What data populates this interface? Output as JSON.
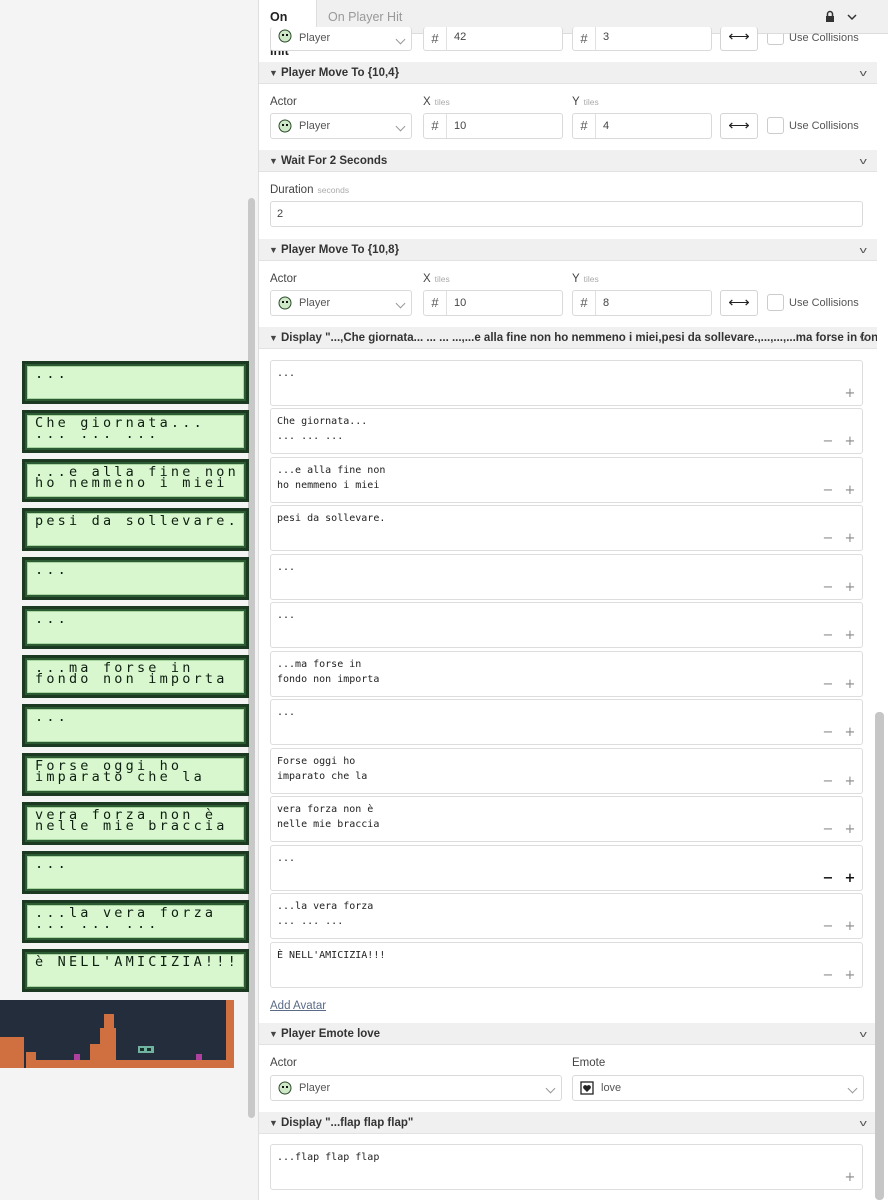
{
  "tabs": {
    "active": "On Init",
    "inactive": "On Player Hit"
  },
  "tab_icons": [
    "lock-icon",
    "chevron-down-icon"
  ],
  "top_partial": {
    "actor": "Player",
    "x": "42",
    "y": "3",
    "collisions_label": "Use Collisions"
  },
  "move1": {
    "header": "Player Move To {10,4}",
    "actor_label": "Actor",
    "x_label": "X",
    "y_label": "Y",
    "unit": "tiles",
    "actor": "Player",
    "x": "10",
    "y": "4",
    "collisions_label": "Use Collisions"
  },
  "wait": {
    "header": "Wait For 2 Seconds",
    "label": "Duration",
    "unit": "seconds",
    "value": "2"
  },
  "move2": {
    "header": "Player Move To {10,8}",
    "actor_label": "Actor",
    "x_label": "X",
    "y_label": "Y",
    "unit": "tiles",
    "actor": "Player",
    "x": "10",
    "y": "8",
    "collisions_label": "Use Collisions"
  },
  "display1": {
    "header": "Display \"...,Che giornata... ... ... ...,...e alla fine non ho nemmeno i miei,pesi da sollevare.,...,...,...ma forse in fond...",
    "dialogues": [
      {
        "l1": "...",
        "l2": ""
      },
      {
        "l1": "Che giornata...",
        "l2": "... ... ..."
      },
      {
        "l1": "...e alla fine non",
        "l2": "ho nemmeno i miei"
      },
      {
        "l1": "pesi da sollevare.",
        "l2": ""
      },
      {
        "l1": "...",
        "l2": ""
      },
      {
        "l1": "...",
        "l2": ""
      },
      {
        "l1": "...ma forse in",
        "l2": "fondo non importa"
      },
      {
        "l1": "...",
        "l2": ""
      },
      {
        "l1": "Forse oggi ho",
        "l2": "imparato che la"
      },
      {
        "l1": "vera forza non è",
        "l2": "nelle mie braccia"
      },
      {
        "l1": "...",
        "l2": ""
      },
      {
        "l1": "...la vera forza",
        "l2": "... ... ..."
      },
      {
        "l1": "È NELL'AMICIZIA!!!",
        "l2": ""
      }
    ],
    "add_avatar": "Add Avatar"
  },
  "emote": {
    "header": "Player Emote love",
    "actor_label": "Actor",
    "emote_label": "Emote",
    "actor": "Player",
    "emote": "love"
  },
  "display2": {
    "header": "Display \"...flap flap flap\"",
    "dialogue": "...flap flap flap"
  },
  "preview": [
    {
      "l1": "...",
      "l2": ""
    },
    {
      "l1": "Che giornata...",
      "l2": "... ... ..."
    },
    {
      "l1": "...e alla fine non",
      "l2": "ho nemmeno i miei"
    },
    {
      "l1": "pesi da sollevare.",
      "l2": ""
    },
    {
      "l1": "...",
      "l2": ""
    },
    {
      "l1": "...",
      "l2": ""
    },
    {
      "l1": "...ma forse in",
      "l2": "fondo non importa"
    },
    {
      "l1": "...",
      "l2": ""
    },
    {
      "l1": "Forse oggi ho",
      "l2": "imparato che la"
    },
    {
      "l1": "vera forza non è",
      "l2": "nelle mie braccia"
    },
    {
      "l1": "...",
      "l2": ""
    },
    {
      "l1": "...la vera forza",
      "l2": "... ... ..."
    },
    {
      "l1": "è NELL'AMICIZIA!!!",
      "l2": ""
    }
  ],
  "colors": {
    "gb_light": "#d8f7cf",
    "gb_dark": "#1c3a22",
    "scene_bg": "#232d3c",
    "brick": "#d07040"
  }
}
